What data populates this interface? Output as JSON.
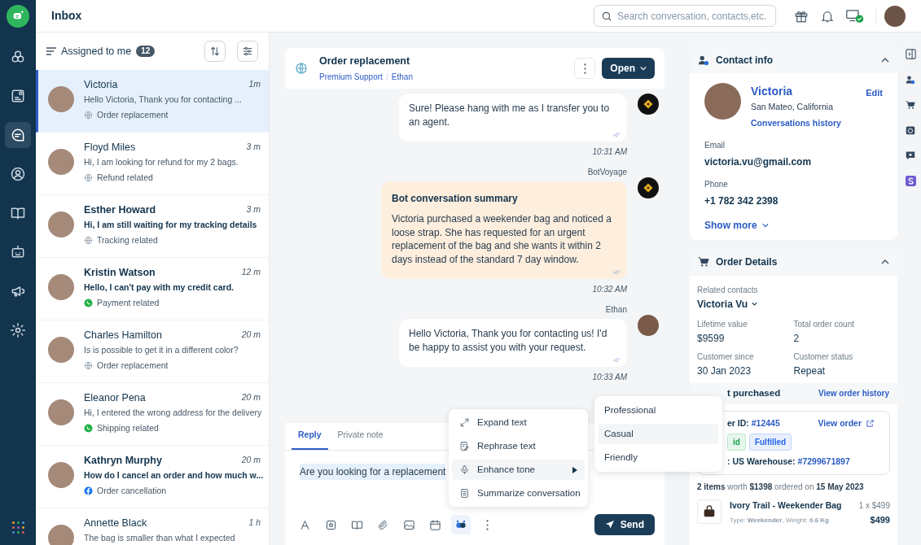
{
  "header": {
    "title": "Inbox",
    "search": {
      "placeholder": "Search conversation, contacts,etc."
    }
  },
  "rail": {
    "items": [
      {
        "selected": false
      },
      {
        "selected": false
      },
      {
        "selected": true
      },
      {
        "selected": false
      },
      {
        "selected": false
      },
      {
        "selected": false
      },
      {
        "selected": false
      },
      {
        "selected": false
      }
    ]
  },
  "list": {
    "filter": "Assigned to me",
    "count": "12",
    "conversations": [
      {
        "name": "Victoria",
        "time": "1m",
        "preview": "Hello Victoria, Thank you for contacting ...",
        "tag": "Order replacement",
        "kind": "web",
        "unread": false,
        "selected": true
      },
      {
        "name": "Floyd Miles",
        "time": "3 m",
        "preview": "Hi, I am looking for refund for my 2 bags.",
        "tag": "Refund related",
        "kind": "web",
        "unread": false,
        "selected": false
      },
      {
        "name": "Esther Howard",
        "time": "3 m",
        "preview": "Hi, I am still waiting for my tracking details",
        "tag": "Tracking related",
        "kind": "web",
        "unread": true,
        "selected": false
      },
      {
        "name": "Kristin Watson",
        "time": "12 m",
        "preview": "Hello, I can't pay with my credit card.",
        "tag": "Payment related",
        "kind": "whatsapp",
        "unread": true,
        "selected": false
      },
      {
        "name": "Charles Hamilton",
        "time": "20 m",
        "preview": "Is is possible to get it in a different color?",
        "tag": "Order replacement",
        "kind": "web",
        "unread": false,
        "selected": false
      },
      {
        "name": "Eleanor Pena",
        "time": "20 m",
        "preview": "Hi, I entered the wrong address for the delivery",
        "tag": "Shipping related",
        "kind": "whatsapp",
        "unread": false,
        "selected": false
      },
      {
        "name": "Kathryn Murphy",
        "time": "20 m",
        "preview": "How do I cancel an order and how much w...",
        "tag": "Order cancellation",
        "kind": "facebook",
        "unread": true,
        "selected": false
      },
      {
        "name": "Annette Black",
        "time": "1 h",
        "preview": "The bag is smaller than what I expected",
        "unread": false,
        "selected": false
      }
    ]
  },
  "chat": {
    "title": "Order replacement",
    "group": "Premium Support",
    "agent": "Ethan",
    "status": "Open",
    "messages": [
      {
        "kind": "bot",
        "text": "Sure! Please hang with me as I transfer you to an agent.",
        "time": "10:31 AM"
      },
      {
        "kind": "summary",
        "sender": "BotVoyage",
        "heading": "Bot conversation summary",
        "text": "Victoria purchased a weekender bag and noticed a loose strap. She has requested for an urgent replacement of the bag and she wants it within 2 days instead of the standard 7 day window.",
        "time": "10:32 AM"
      },
      {
        "kind": "agent",
        "sender": "Ethan",
        "text": "Hello Victoria, Thank you for contacting us! I'd be happy to assist you with your request.",
        "time": "10:33 AM"
      }
    ],
    "composer": {
      "tabs": [
        {
          "label": "Reply",
          "selected": true
        },
        {
          "label": "Private note",
          "selected": false
        }
      ],
      "value": "Are you looking for a replacement",
      "tools": [
        {
          "selected": false
        },
        {
          "selected": false
        },
        {
          "selected": false
        },
        {
          "selected": false
        },
        {
          "selected": false
        },
        {
          "selected": false
        },
        {
          "selected": true
        },
        {
          "selected": false
        }
      ],
      "send": "Send"
    },
    "ai_menu": [
      {
        "label": "Expand text",
        "selected": false,
        "submenu": false
      },
      {
        "label": "Rephrase text",
        "selected": false,
        "submenu": false
      },
      {
        "label": "Enhance tone",
        "selected": true,
        "submenu": true
      },
      {
        "label": "Summarize conversation",
        "selected": false,
        "submenu": false
      }
    ],
    "tone_menu": [
      {
        "label": "Professional",
        "selected": false
      },
      {
        "label": "Casual",
        "selected": true
      },
      {
        "label": "Friendly",
        "selected": false
      }
    ]
  },
  "contact": {
    "heading": "Contact info",
    "name": "Victoria",
    "location": "San Mateo, California",
    "history": "Conversations history",
    "edit": "Edit",
    "fields": [
      {
        "label": "Email",
        "value": "victoria.vu@gmail.com"
      },
      {
        "label": "Phone",
        "value": "+1 782 342 2398"
      }
    ],
    "more": "Show more"
  },
  "order": {
    "heading": "Order Details",
    "related_label": "Related contacts",
    "related": "Victoria Vu",
    "stats": [
      {
        "label": "Lifetime value",
        "value": "$9599"
      },
      {
        "label": "Total order count",
        "value": "2"
      },
      {
        "label": "Customer since",
        "value": "30 Jan 2023"
      },
      {
        "label": "Customer status",
        "value": "Repeat"
      }
    ],
    "section": "t purchased",
    "history_link": "View order history",
    "card": {
      "id_label": "er ID:",
      "id": "#12445",
      "view": "View order",
      "tags": [
        {
          "label": "id",
          "color": "#16a34a"
        },
        {
          "label": "Fulfilled",
          "color": "#2563eb"
        }
      ],
      "warehouse_label": ": US Warehouse:",
      "warehouse": "#7299671897"
    },
    "summary": "**2 items** worth **$1398** ordered on **15 May 2023**",
    "product": {
      "name": "Ivory Trail - Weekender Bag",
      "meta": "Type: **Weekender**, Weight: **0.6 Kg**",
      "qty": "1 x $499",
      "total": "$499"
    }
  }
}
